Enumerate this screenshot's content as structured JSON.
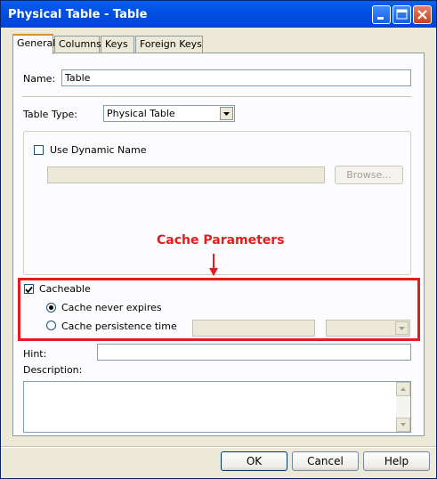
{
  "window": {
    "title": "Physical Table - Table"
  },
  "tabs": [
    {
      "label": "General"
    },
    {
      "label": "Columns"
    },
    {
      "label": "Keys"
    },
    {
      "label": "Foreign Keys"
    }
  ],
  "form": {
    "name_label": "Name:",
    "name_value": "Table",
    "table_type_label": "Table Type:",
    "table_type_value": "Physical Table",
    "use_dynamic_name_label": "Use Dynamic Name",
    "use_dynamic_name_checked": false,
    "dynamic_name_value": "",
    "browse_label": "Browse...",
    "cacheable_label": "Cacheable",
    "cacheable_checked": true,
    "cache_never_expires_label": "Cache never expires",
    "cache_never_expires_selected": true,
    "cache_persistence_label": "Cache persistence time",
    "cache_persistence_selected": false,
    "hint_label": "Hint:",
    "hint_value": "",
    "description_label": "Description:",
    "description_value": ""
  },
  "annotation": {
    "title": "Cache Parameters",
    "color": "#e31d1d"
  },
  "buttons": {
    "ok": "OK",
    "cancel": "Cancel",
    "help": "Help"
  }
}
